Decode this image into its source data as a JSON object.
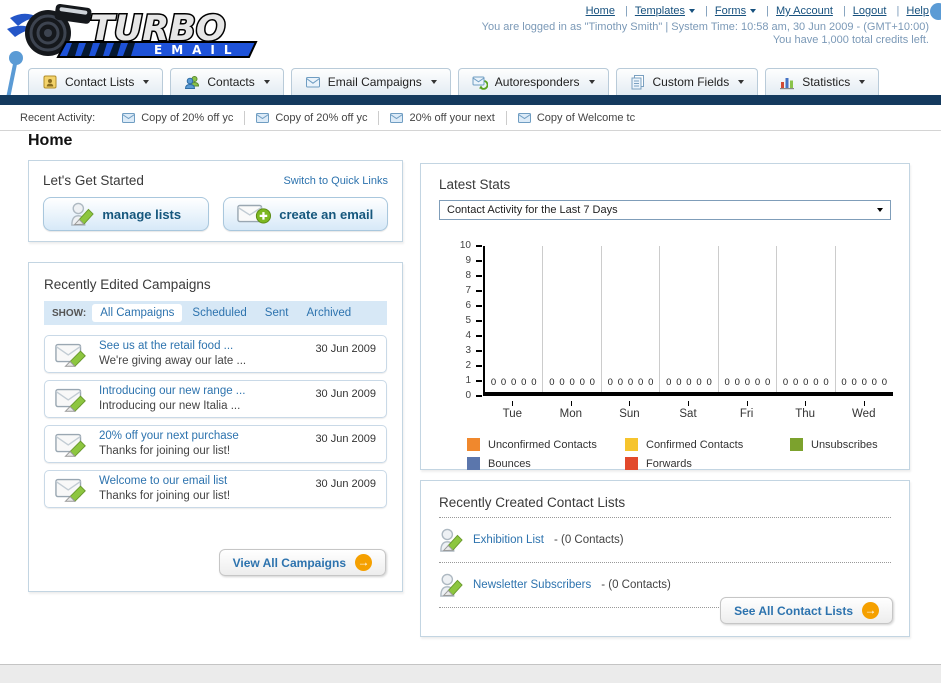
{
  "header": {
    "logo": {
      "title": "TURBO",
      "subtitle": "EMAIL"
    },
    "nav_links": [
      {
        "label": "Home",
        "dropdown": false
      },
      {
        "label": "Templates",
        "dropdown": true
      },
      {
        "label": "Forms",
        "dropdown": true
      },
      {
        "label": "My Account",
        "dropdown": false
      },
      {
        "label": "Logout",
        "dropdown": false
      },
      {
        "label": "Help",
        "dropdown": false
      }
    ],
    "login_status": "You are logged in as \"Timothy Smith\" | System Time: 10:58 am, 30 Jun 2009 - (GMT+10:00)",
    "credits_note": "You have 1,000 total credits left."
  },
  "nav_tabs": [
    {
      "label": "Contact Lists"
    },
    {
      "label": "Contacts"
    },
    {
      "label": "Email Campaigns"
    },
    {
      "label": "Autoresponders"
    },
    {
      "label": "Custom Fields"
    },
    {
      "label": "Statistics"
    }
  ],
  "recent_activity": {
    "label": "Recent Activity:",
    "items": [
      {
        "text": "Copy of 20% off yc"
      },
      {
        "text": "Copy of 20% off yc"
      },
      {
        "text": "20% off your next"
      },
      {
        "text": "Copy of Welcome tc"
      }
    ]
  },
  "page_title": "Home",
  "get_started": {
    "title": "Let's Get Started",
    "switch_link": "Switch to Quick Links",
    "manage_lists_label": "manage lists",
    "create_email_label": "create an email"
  },
  "campaigns": {
    "title": "Recently Edited Campaigns",
    "show_label": "SHOW:",
    "filters": [
      {
        "label": "All Campaigns",
        "active": true
      },
      {
        "label": "Scheduled",
        "active": false
      },
      {
        "label": "Sent",
        "active": false
      },
      {
        "label": "Archived",
        "active": false
      }
    ],
    "items": [
      {
        "title": "See us at the retail food ...",
        "subtitle": "We're giving away our late ...",
        "date": "30 Jun 2009"
      },
      {
        "title": "Introducing our new range ...",
        "subtitle": "Introducing our new Italia ...",
        "date": "30 Jun 2009"
      },
      {
        "title": "20% off your next purchase",
        "subtitle": "Thanks for joining our list!",
        "date": "30 Jun 2009"
      },
      {
        "title": "Welcome to our email list",
        "subtitle": "Thanks for joining our list!",
        "date": "30 Jun 2009"
      }
    ],
    "view_all_label": "View All Campaigns"
  },
  "latest_stats": {
    "title": "Latest Stats",
    "filter_value": "Contact Activity for the Last 7 Days"
  },
  "chart_data": {
    "type": "bar",
    "title": "Contact Activity for the Last 7 Days",
    "categories": [
      "Tue",
      "Mon",
      "Sun",
      "Sat",
      "Fri",
      "Thu",
      "Wed"
    ],
    "series": [
      {
        "name": "Unconfirmed Contacts",
        "color": "#f0882d",
        "values": [
          0,
          0,
          0,
          0,
          0,
          0,
          0
        ]
      },
      {
        "name": "Confirmed Contacts",
        "color": "#f6c42d",
        "values": [
          0,
          0,
          0,
          0,
          0,
          0,
          0
        ]
      },
      {
        "name": "Unsubscribes",
        "color": "#7ca22d",
        "values": [
          0,
          0,
          0,
          0,
          0,
          0,
          0
        ]
      },
      {
        "name": "Bounces",
        "color": "#5b76ac",
        "values": [
          0,
          0,
          0,
          0,
          0,
          0,
          0
        ]
      },
      {
        "name": "Forwards",
        "color": "#e2492c",
        "values": [
          0,
          0,
          0,
          0,
          0,
          0,
          0
        ]
      }
    ],
    "ylim": [
      0,
      10
    ],
    "yticks": [
      0,
      1,
      2,
      3,
      4,
      5,
      6,
      7,
      8,
      9,
      10
    ],
    "grid": true,
    "legend_position": "bottom",
    "value_labels": true,
    "xlabel": "",
    "ylabel": ""
  },
  "contact_lists": {
    "title": "Recently Created Contact Lists",
    "items": [
      {
        "name": "Exhibition List",
        "detail": "- (0 Contacts)"
      },
      {
        "name": "Newsletter Subscribers",
        "detail": "- (0 Contacts)"
      }
    ],
    "see_all_label": "See All Contact Lists"
  },
  "icons": {
    "forward_arrow": "→"
  }
}
